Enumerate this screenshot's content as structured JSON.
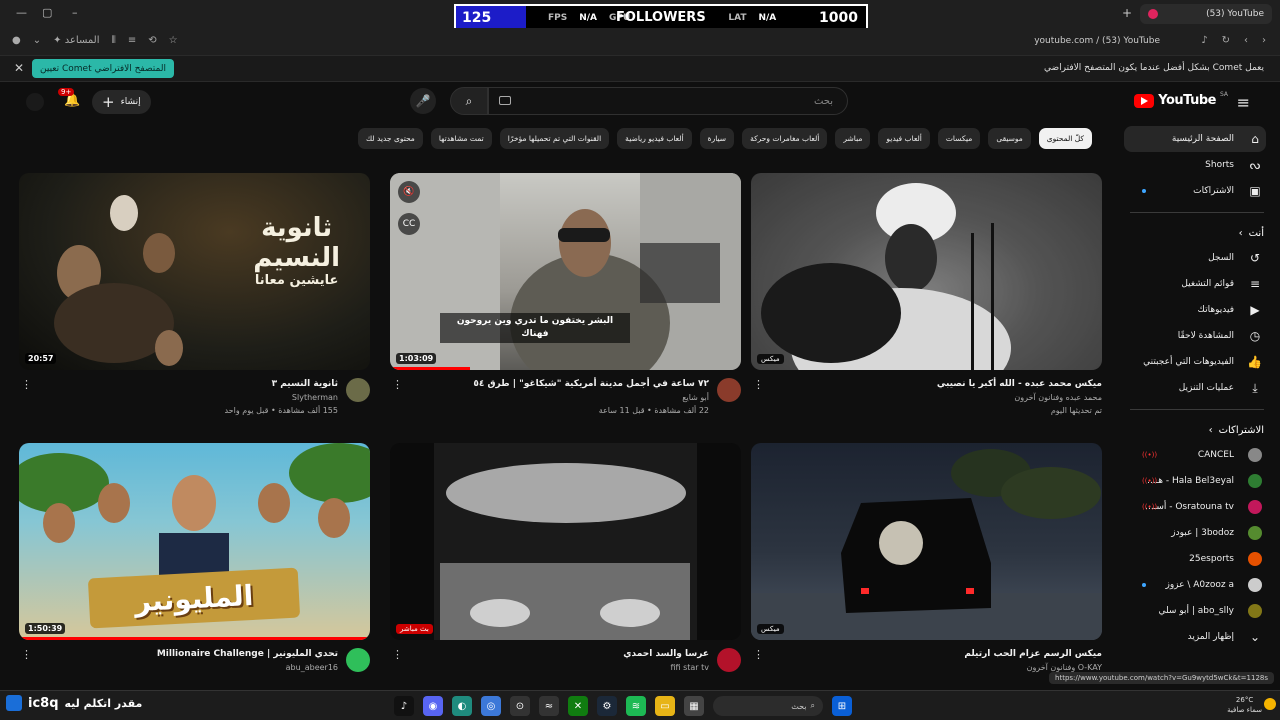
{
  "browser": {
    "tab_title": "(53) YouTube",
    "new_tab": "+",
    "url": "youtube.com / (53) YouTube",
    "assistant_label": "المساعد",
    "infobar_message": "يعمل Comet بشكل أفضل عندما يكون المتصفح الافتراضي",
    "infobar_button": "تعيين Comet المتصفح الافتراضي"
  },
  "overlay": {
    "left_count": "125",
    "fps_label": "FPS",
    "fps_value": "N/A",
    "gpu_label": "GPU",
    "followers_label": "FOLLOWERS",
    "lat_label": "LAT",
    "lat_value": "N/A",
    "right_count": "1000"
  },
  "header": {
    "logo_text": "YouTube",
    "region": "SA",
    "search_placeholder": "بحث",
    "create_label": "إنشاء",
    "notif_count": "9+"
  },
  "sidebar": {
    "main": [
      {
        "label": "الصفحة الرئيسية",
        "icon": "home-icon",
        "glyph": "⌂"
      },
      {
        "label": "Shorts",
        "icon": "shorts-icon",
        "glyph": "ᔓ"
      },
      {
        "label": "الاشتراكات",
        "icon": "subscriptions-icon",
        "glyph": "▣"
      }
    ],
    "you_header": "أنت",
    "you": [
      {
        "label": "السجل",
        "icon": "history-icon",
        "glyph": "↺"
      },
      {
        "label": "قوائم التشغيل",
        "icon": "playlist-icon",
        "glyph": "≡"
      },
      {
        "label": "فيديوهاتك",
        "icon": "your-videos-icon",
        "glyph": "▶"
      },
      {
        "label": "المشاهدة لاحقًا",
        "icon": "watch-later-icon",
        "glyph": "◷"
      },
      {
        "label": "الفيديوهات التي أعجبتني",
        "icon": "liked-icon",
        "glyph": "👍"
      },
      {
        "label": "عمليات التنزيل",
        "icon": "download-icon",
        "glyph": "⤓"
      }
    ],
    "subs_header": "الاشتراكات",
    "subs": [
      {
        "label": "CANCEL",
        "color": "#888888",
        "status": "live"
      },
      {
        "label": "Hala Bel3eyal - هـ...",
        "color": "#2e7d32",
        "status": "live"
      },
      {
        "label": "Osratouna tv - أسـ...",
        "color": "#c2185b",
        "status": "live"
      },
      {
        "label": "3bodoz | عبودز",
        "color": "#558b2f",
        "status": ""
      },
      {
        "label": "25esports",
        "color": "#e65100",
        "status": ""
      },
      {
        "label": "A0zooz a \\ عزوز",
        "color": "#cccccc",
        "status": "dot"
      },
      {
        "label": "abo_slly | أبو سلي",
        "color": "#827717",
        "status": ""
      }
    ],
    "show_more": "إظهار المزيد"
  },
  "chips": [
    "كلّ المحتوى",
    "موسيقى",
    "ميكسات",
    "ألعاب فيديو",
    "مباشر",
    "ألعاب مغامرات وحركة",
    "سيارة",
    "ألعاب فيديو رياضية",
    "القنوات التي تم تحميلها مؤخرًا",
    "تمت مشاهدتها",
    "محتوى جديد لك"
  ],
  "videos": [
    {
      "title": "ميكس محمد عبده - الله أكبر يا نصيبي",
      "channel": "محمد عبده وفنانون آخرون",
      "stats": "تم تحديثها اليوم",
      "badge": "ميكس",
      "has_avatar": false
    },
    {
      "title": "٧٢ ساعة في أجمل مدينة أمريكية \"شيكاغو\" | طرق ٥٤",
      "channel": "أبو شايع",
      "stats": "22 ألف مشاهدة • قبل 11 ساعة",
      "duration": "1:03:09",
      "subtitle_1": "البشر يختفون ما تدري وين يروحون فهناك",
      "has_avatar": true
    },
    {
      "title": "ثانوية النسيم ٣",
      "channel": "Slytherman",
      "stats": "155 ألف مشاهدة • قبل يوم واحد",
      "duration": "20:57",
      "thumb_text_1": "ثانوية",
      "thumb_text_2": "النسيم",
      "thumb_text_3": "عايشين معانا",
      "has_avatar": true
    },
    {
      "title": "ميكس الرسم عزام الحب ارتيلم",
      "channel": "O-KAY وفنانون آخرون",
      "stats": "",
      "badge": "ميكس",
      "has_avatar": false
    },
    {
      "title": "عرسا والسد احمدي",
      "channel": "fifi star tv",
      "stats": "",
      "badge": "بث مباشر",
      "has_avatar": true
    },
    {
      "title": "تحدي المليونير | Millionaire Challenge",
      "channel": "abu_abeer16",
      "stats": "",
      "duration": "1:50:39",
      "thumb_text_1": "المليونير",
      "has_avatar": true
    }
  ],
  "status_url": "https://www.youtube.com/watch?v=Gu9wytd5wCk&t=1128s",
  "taskbar": {
    "overlay_text": "مقدر اتكلم ليه",
    "left_big": "ic8q",
    "time_small": "2:55",
    "search_label": "بحث",
    "temperature": "26°C",
    "weather": "سماء صافية"
  }
}
